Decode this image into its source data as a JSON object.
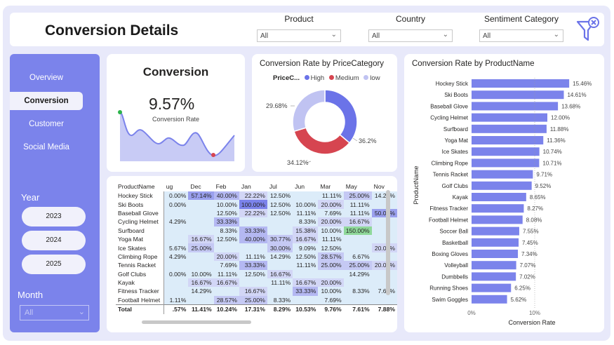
{
  "header": {
    "title": "Conversion Details",
    "slicers": [
      {
        "label": "Product",
        "value": "All"
      },
      {
        "label": "Country",
        "value": "All"
      },
      {
        "label": "Sentiment Category",
        "value": "All"
      }
    ]
  },
  "nav": {
    "items": [
      "Overview",
      "Conversion",
      "Customer",
      "Social Media"
    ],
    "active": "Conversion",
    "year_title": "Year",
    "years": [
      "2023",
      "2024",
      "2025"
    ],
    "month_title": "Month",
    "month_value": "All"
  },
  "kpi": {
    "title": "Conversion",
    "value": "9.57%",
    "label": "Conversion Rate"
  },
  "donut": {
    "title": "Conversion Rate by PriceCategory",
    "legend_title": "PriceC...",
    "legend": [
      {
        "name": "High",
        "color": "#6b73e8"
      },
      {
        "name": "Medium",
        "color": "#d64550"
      },
      {
        "name": "low",
        "color": "#c0c3f2"
      }
    ],
    "labels": [
      "36.2%",
      "34.12%",
      "29.68%"
    ]
  },
  "matrix": {
    "columns": [
      "ProductName",
      "ug",
      "Dec",
      "Feb",
      "Jan",
      "Jul",
      "Jun",
      "Mar",
      "May",
      "Nov"
    ],
    "rows": [
      [
        "Hockey Stick",
        "0.00%",
        "57.14%",
        "40.00%",
        "22.22%",
        "12.50%",
        "",
        "11.11%",
        "25.00%",
        "14.29%"
      ],
      [
        "Ski Boots",
        "0.00%",
        "",
        "10.00%",
        "100.00%",
        "12.50%",
        "10.00%",
        "20.00%",
        "11.11%",
        ""
      ],
      [
        "Baseball Glove",
        "",
        "",
        "12.50%",
        "22.22%",
        "12.50%",
        "11.11%",
        "7.69%",
        "11.11%",
        "50.00%"
      ],
      [
        "Cycling Helmet",
        "4.29%",
        "",
        "33.33%",
        "",
        "",
        "8.33%",
        "20.00%",
        "16.67%",
        ""
      ],
      [
        "Surfboard",
        "",
        "",
        "8.33%",
        "33.33%",
        "",
        "15.38%",
        "10.00%",
        "150.00%",
        ""
      ],
      [
        "Yoga Mat",
        "",
        "16.67%",
        "12.50%",
        "40.00%",
        "30.77%",
        "16.67%",
        "11.11%",
        "",
        ""
      ],
      [
        "Ice Skates",
        "5.67%",
        "25.00%",
        "",
        "",
        "30.00%",
        "9.09%",
        "12.50%",
        "",
        "20.00%"
      ],
      [
        "Climbing Rope",
        "4.29%",
        "",
        "20.00%",
        "11.11%",
        "14.29%",
        "12.50%",
        "28.57%",
        "6.67%",
        ""
      ],
      [
        "Tennis Racket",
        "",
        "",
        "7.69%",
        "33.33%",
        "",
        "11.11%",
        "25.00%",
        "25.00%",
        "20.00%"
      ],
      [
        "Golf Clubs",
        "0.00%",
        "10.00%",
        "11.11%",
        "12.50%",
        "16.67%",
        "",
        "",
        "14.29%",
        ""
      ],
      [
        "Kayak",
        "",
        "16.67%",
        "16.67%",
        "",
        "11.11%",
        "16.67%",
        "20.00%",
        "",
        ""
      ],
      [
        "Fitness Tracker",
        "",
        "14.29%",
        "",
        "16.67%",
        "",
        "33.33%",
        "10.00%",
        "8.33%",
        "7.69%"
      ],
      [
        "Football Helmet",
        "1.11%",
        "",
        "28.57%",
        "25.00%",
        "8.33%",
        "",
        "7.69%",
        "",
        ""
      ]
    ],
    "total": [
      "Total",
      ".57%",
      "11.41%",
      "10.24%",
      "17.31%",
      "8.29%",
      "10.53%",
      "9.76%",
      "7.61%",
      "7.88%"
    ]
  },
  "chart_data": {
    "type": "bar",
    "title": "Conversion Rate by ProductName",
    "xlabel": "Conversion Rate",
    "ylabel": "ProductName",
    "categories": [
      "Hockey Stick",
      "Ski Boots",
      "Baseball Glove",
      "Cycling Helmet",
      "Surfboard",
      "Yoga Mat",
      "Ice Skates",
      "Climbing Rope",
      "Tennis Racket",
      "Golf Clubs",
      "Kayak",
      "Fitness Tracker",
      "Football Helmet",
      "Soccer Ball",
      "Basketball",
      "Boxing Gloves",
      "Volleyball",
      "Dumbbells",
      "Running Shoes",
      "Swim Goggles"
    ],
    "values": [
      15.46,
      14.61,
      13.68,
      12.0,
      11.88,
      11.36,
      10.74,
      10.71,
      9.71,
      9.52,
      8.65,
      8.27,
      8.08,
      7.55,
      7.45,
      7.34,
      7.07,
      7.02,
      6.25,
      5.62
    ],
    "value_labels": [
      "15.46%",
      "14.61%",
      "13.68%",
      "12.00%",
      "11.88%",
      "11.36%",
      "10.74%",
      "10.71%",
      "9.71%",
      "9.52%",
      "8.65%",
      "8.27%",
      "8.08%",
      "7.55%",
      "7.45%",
      "7.34%",
      "7.07%",
      "7.02%",
      "6.25%",
      "5.62%"
    ],
    "xticks": [
      "0%",
      "10%"
    ],
    "xlim": [
      0,
      17
    ],
    "bar_color": "#7b83eb"
  }
}
